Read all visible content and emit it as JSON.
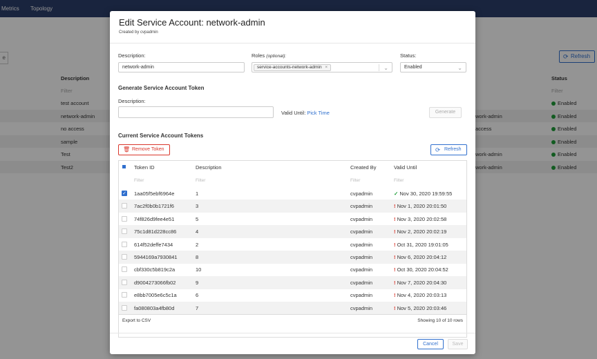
{
  "background": {
    "nav": [
      "Metrics",
      "Topology"
    ],
    "left_button_label": "e",
    "refresh_label": "Refresh",
    "columns": {
      "description": "Description",
      "status": "Status"
    },
    "filter_placeholder": "Filter",
    "rows": [
      {
        "description": "test account",
        "right": "",
        "status": "Enabled"
      },
      {
        "description": "network-admin",
        "right": "work-admin",
        "status": "Enabled"
      },
      {
        "description": "no access",
        "right": "access",
        "status": "Enabled"
      },
      {
        "description": "sample",
        "right": "",
        "status": "Enabled"
      },
      {
        "description": "Test",
        "right": "work-admin",
        "status": "Enabled"
      },
      {
        "description": "Test2",
        "right": "work-admin",
        "status": "Enabled"
      }
    ]
  },
  "modal": {
    "title": "Edit Service Account: network-admin",
    "subtitle": "Created by cvpadmin",
    "description_label": "Description:",
    "description_value": "network-admin",
    "roles_label": "Roles",
    "roles_optional": "(optional):",
    "role_chip": "service-accounts-network-admin",
    "role_chip_remove": "×",
    "status_label": "Status:",
    "status_value": "Enabled",
    "generate_section": "Generate Service Account Token",
    "token_description_label": "Description:",
    "token_description_value": "",
    "valid_until_label": "Valid Until:",
    "pick_time_label": "Pick Time",
    "generate_label": "Generate",
    "current_section": "Current Service Account Tokens",
    "remove_token_label": "Remove Token",
    "refresh_label": "Refresh",
    "table": {
      "columns": [
        "Token ID",
        "Description",
        "Created By",
        "Valid Until"
      ],
      "filter_placeholder": "Filter",
      "rows": [
        {
          "checked": true,
          "token_id": "1aa05f5ebf6964e",
          "description": "1",
          "created_by": "cvpadmin",
          "valid_until": "Nov 30, 2020 19:59:55",
          "status": "ok"
        },
        {
          "checked": false,
          "token_id": "7ac2f0b0b1721f6",
          "description": "3",
          "created_by": "cvpadmin",
          "valid_until": "Nov 1, 2020 20:01:50",
          "status": "warn"
        },
        {
          "checked": false,
          "token_id": "74f826d9fee4e51",
          "description": "5",
          "created_by": "cvpadmin",
          "valid_until": "Nov 3, 2020 20:02:58",
          "status": "warn"
        },
        {
          "checked": false,
          "token_id": "75c1d81d228cc86",
          "description": "4",
          "created_by": "cvpadmin",
          "valid_until": "Nov 2, 2020 20:02:19",
          "status": "warn"
        },
        {
          "checked": false,
          "token_id": "614f52deffe7434",
          "description": "2",
          "created_by": "cvpadmin",
          "valid_until": "Oct 31, 2020 19:01:05",
          "status": "warn"
        },
        {
          "checked": false,
          "token_id": "5944169a7930841",
          "description": "8",
          "created_by": "cvpadmin",
          "valid_until": "Nov 6, 2020 20:04:12",
          "status": "warn"
        },
        {
          "checked": false,
          "token_id": "cbf330c5b819c2a",
          "description": "10",
          "created_by": "cvpadmin",
          "valid_until": "Oct 30, 2020 20:04:52",
          "status": "warn"
        },
        {
          "checked": false,
          "token_id": "d9004273066fb02",
          "description": "9",
          "created_by": "cvpadmin",
          "valid_until": "Nov 7, 2020 20:04:30",
          "status": "warn"
        },
        {
          "checked": false,
          "token_id": "e8bb7005e6c5c1a",
          "description": "6",
          "created_by": "cvpadmin",
          "valid_until": "Nov 4, 2020 20:03:13",
          "status": "warn"
        },
        {
          "checked": false,
          "token_id": "fa080803a4fb80d",
          "description": "7",
          "created_by": "cvpadmin",
          "valid_until": "Nov 5, 2020 20:03:46",
          "status": "warn"
        }
      ],
      "export_label": "Export to CSV",
      "showing_label": "Showing 10 of 10 rows"
    },
    "cancel_label": "Cancel",
    "save_label": "Save"
  }
}
